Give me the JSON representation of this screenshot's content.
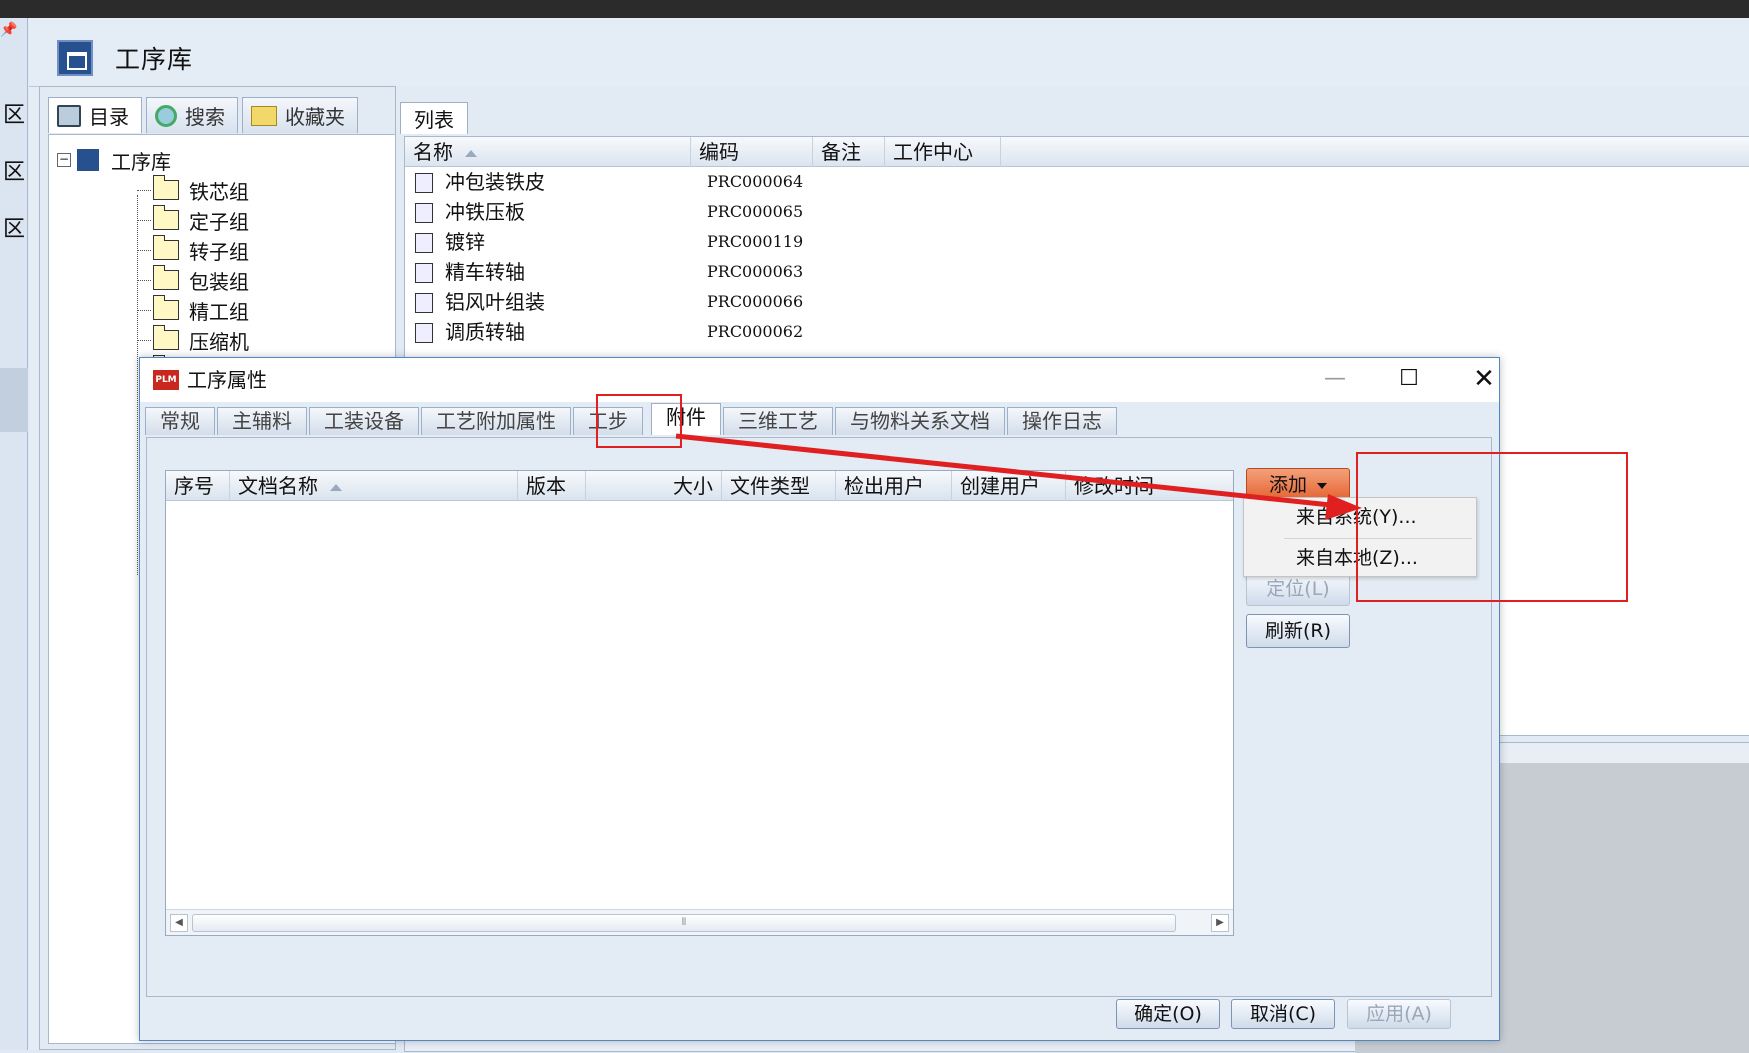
{
  "left_strip": {
    "pin_glyph": "📌",
    "items": [
      "区",
      "区",
      "区"
    ]
  },
  "app": {
    "title": "工序库"
  },
  "left_panel": {
    "tabs": [
      {
        "label": "目录",
        "icon": "computer-icon"
      },
      {
        "label": "搜索",
        "icon": "search-globe-icon"
      },
      {
        "label": "收藏夹",
        "icon": "favorites-icon"
      }
    ],
    "tree": {
      "root": "工序库",
      "children": [
        "铁芯组",
        "定子组",
        "转子组",
        "包装组",
        "精工组",
        "压缩机"
      ]
    }
  },
  "list_panel": {
    "tab": "列表",
    "columns": [
      "名称",
      "编码",
      "备注",
      "工作中心"
    ],
    "rows": [
      {
        "name": "冲包装铁皮",
        "code": "PRC000064"
      },
      {
        "name": "冲铁压板",
        "code": "PRC000065"
      },
      {
        "name": "镀锌",
        "code": "PRC000119"
      },
      {
        "name": "精车转轴",
        "code": "PRC000063"
      },
      {
        "name": "铝风叶组装",
        "code": "PRC000066"
      },
      {
        "name": "调质转轴",
        "code": "PRC000062"
      }
    ]
  },
  "dialog": {
    "logo_text": "PLM",
    "title": "工序属性",
    "window_buttons": {
      "minimize": "—",
      "maximize": "☐",
      "close": "✕"
    },
    "tabs": [
      "常规",
      "主辅料",
      "工装设备",
      "工艺附加属性",
      "工步",
      "附件",
      "三维工艺",
      "与物料关系文档",
      "操作日志"
    ],
    "active_tab": "附件",
    "grid": {
      "columns": [
        "序号",
        "文档名称",
        "版本",
        "大小",
        "文件类型",
        "检出用户",
        "创建用户",
        "修改时间"
      ],
      "rows": [],
      "scroll_thumb_grip": "⦀"
    },
    "side_buttons": {
      "add": "添加",
      "locate": "定位(L)",
      "refresh": "刷新(R)"
    },
    "add_menu": [
      "来自系统(Y)...",
      "来自本地(Z)..."
    ],
    "footer_buttons": {
      "ok": "确定(O)",
      "cancel": "取消(C)",
      "apply": "应用(A)"
    }
  },
  "colors": {
    "accent_add": "#e4622f",
    "annotation_red": "#e02020",
    "window_border": "#4e86c7"
  }
}
